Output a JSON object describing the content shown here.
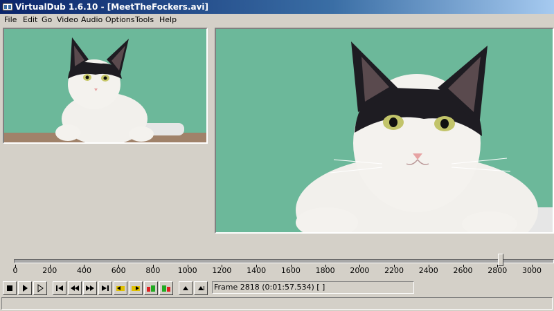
{
  "window": {
    "title": "VirtualDub 1.6.10 - [MeetTheFockers.avi]"
  },
  "menu": [
    {
      "label": "File"
    },
    {
      "label": "Edit"
    },
    {
      "label": "Go"
    },
    {
      "label": "Video"
    },
    {
      "label": "Audio"
    },
    {
      "label": "Options"
    },
    {
      "label": "Tools"
    },
    {
      "label": "Help"
    }
  ],
  "panes": {
    "input": {
      "content": "cat photo",
      "background": "#6cb89a"
    },
    "output": {
      "content": "cat photo",
      "background": "#6cb89a"
    }
  },
  "timeline": {
    "min": 0,
    "max": 3000,
    "current_frame": 2818,
    "ticks": [
      "0",
      "200",
      "400",
      "600",
      "800",
      "1000",
      "1200",
      "1400",
      "1600",
      "1800",
      "2000",
      "2200",
      "2400",
      "2600",
      "2800",
      "3000"
    ]
  },
  "toolbar_buttons": [
    {
      "icon": "stop-icon"
    },
    {
      "icon": "play-input-icon"
    },
    {
      "icon": "play-output-icon"
    },
    {
      "icon": "go-start-icon"
    },
    {
      "icon": "prev-frame-icon"
    },
    {
      "icon": "next-frame-icon"
    },
    {
      "icon": "go-end-icon"
    },
    {
      "icon": "prev-keyframe-icon"
    },
    {
      "icon": "next-keyframe-icon"
    },
    {
      "icon": "prev-scene-icon"
    },
    {
      "icon": "next-scene-icon"
    },
    {
      "icon": "mark-in-icon"
    },
    {
      "icon": "mark-out-icon"
    }
  ],
  "frame_status": {
    "text": "Frame 2818 (0:01:57.534) [ ]"
  },
  "statusbar": {
    "text": ""
  }
}
